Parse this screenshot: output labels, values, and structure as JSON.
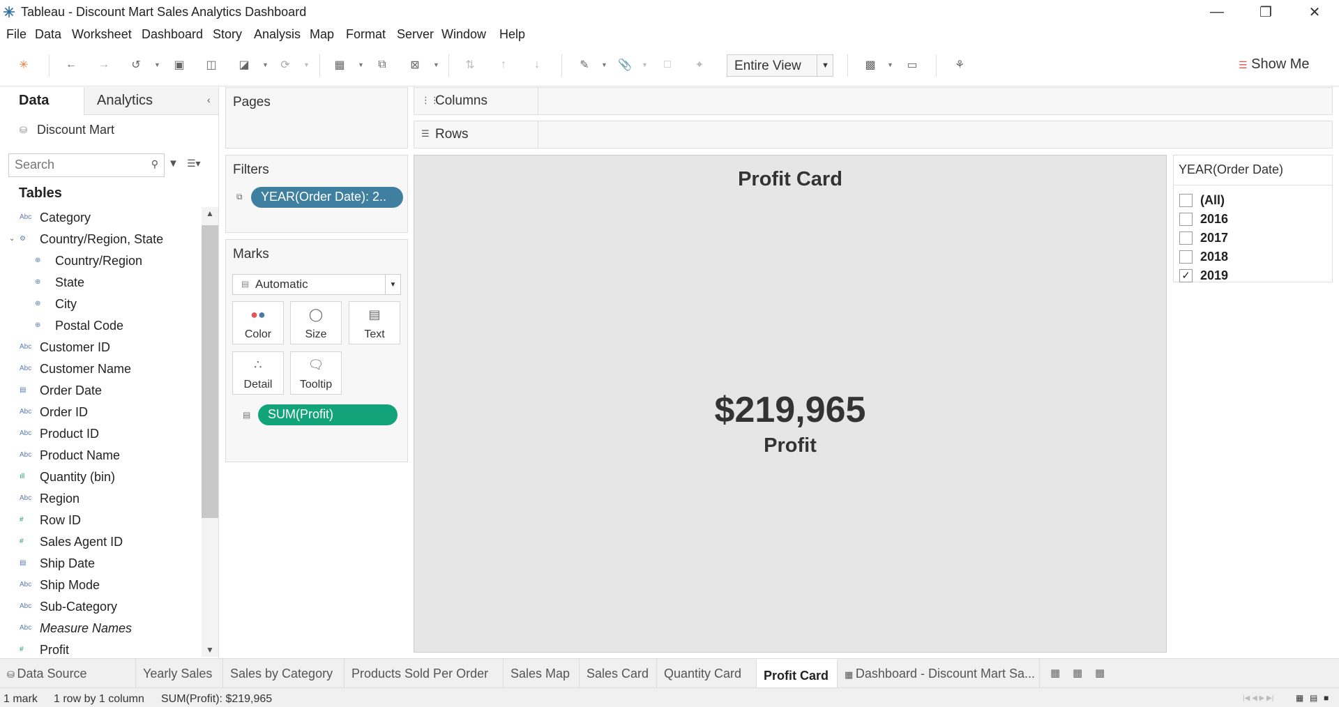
{
  "window": {
    "title": "Tableau - Discount Mart Sales Analytics Dashboard"
  },
  "menu": [
    "File",
    "Data",
    "Worksheet",
    "Dashboard",
    "Story",
    "Analysis",
    "Map",
    "Format",
    "Server",
    "Window",
    "Help"
  ],
  "toolbar": {
    "fit_value": "Entire View",
    "show_me_label": "Show Me"
  },
  "left_panel": {
    "tab_data": "Data",
    "tab_analytics": "Analytics",
    "datasource": "Discount Mart",
    "search_placeholder": "Search",
    "tables_heading": "Tables",
    "fields": [
      {
        "type": "Abc",
        "label": "Category"
      },
      {
        "type": "hier",
        "label": "Country/Region, State"
      },
      {
        "type": "geo",
        "label": "Country/Region"
      },
      {
        "type": "geo",
        "label": "State"
      },
      {
        "type": "geo",
        "label": "City"
      },
      {
        "type": "geo",
        "label": "Postal Code"
      },
      {
        "type": "Abc",
        "label": "Customer ID"
      },
      {
        "type": "Abc",
        "label": "Customer Name"
      },
      {
        "type": "date",
        "label": "Order Date"
      },
      {
        "type": "Abc",
        "label": "Order ID"
      },
      {
        "type": "Abc",
        "label": "Product ID"
      },
      {
        "type": "Abc",
        "label": "Product Name"
      },
      {
        "type": "bin",
        "label": "Quantity (bin)"
      },
      {
        "type": "Abc",
        "label": "Region"
      },
      {
        "type": "num",
        "label": "Row ID"
      },
      {
        "type": "num",
        "label": "Sales Agent ID"
      },
      {
        "type": "date",
        "label": "Ship Date"
      },
      {
        "type": "Abc",
        "label": "Ship Mode"
      },
      {
        "type": "Abc",
        "label": "Sub-Category"
      },
      {
        "type": "Abc",
        "label": "Measure Names"
      },
      {
        "type": "num",
        "label": "Profit"
      }
    ]
  },
  "cards": {
    "pages": "Pages",
    "filters": "Filters",
    "filter_pill": "YEAR(Order Date): 2..",
    "marks": "Marks",
    "marks_type": "Automatic",
    "mark_buttons": [
      "Color",
      "Size",
      "Text",
      "Detail",
      "Tooltip"
    ],
    "measure_pill": "SUM(Profit)"
  },
  "shelves": {
    "columns": "Columns",
    "rows": "Rows"
  },
  "view": {
    "title": "Profit Card",
    "value": "$219,965",
    "label": "Profit"
  },
  "year_filter": {
    "title": "YEAR(Order Date)",
    "options": [
      {
        "label": "(All)",
        "checked": false
      },
      {
        "label": "2016",
        "checked": false
      },
      {
        "label": "2017",
        "checked": false
      },
      {
        "label": "2018",
        "checked": false
      },
      {
        "label": "2019",
        "checked": true
      }
    ]
  },
  "sheet_tabs": [
    {
      "label": "Data Source",
      "active": false
    },
    {
      "label": "Yearly Sales",
      "active": false
    },
    {
      "label": "Sales by Category",
      "active": false
    },
    {
      "label": "Products Sold Per Order",
      "active": false
    },
    {
      "label": "Sales Map",
      "active": false
    },
    {
      "label": "Sales Card",
      "active": false
    },
    {
      "label": "Quantity Card",
      "active": false
    },
    {
      "label": "Profit Card",
      "active": true
    },
    {
      "label": "Dashboard - Discount Mart Sa...",
      "active": false
    }
  ],
  "status": {
    "marks": "1 mark",
    "dims": "1 row by 1 column",
    "sum": "SUM(Profit): $219,965"
  }
}
